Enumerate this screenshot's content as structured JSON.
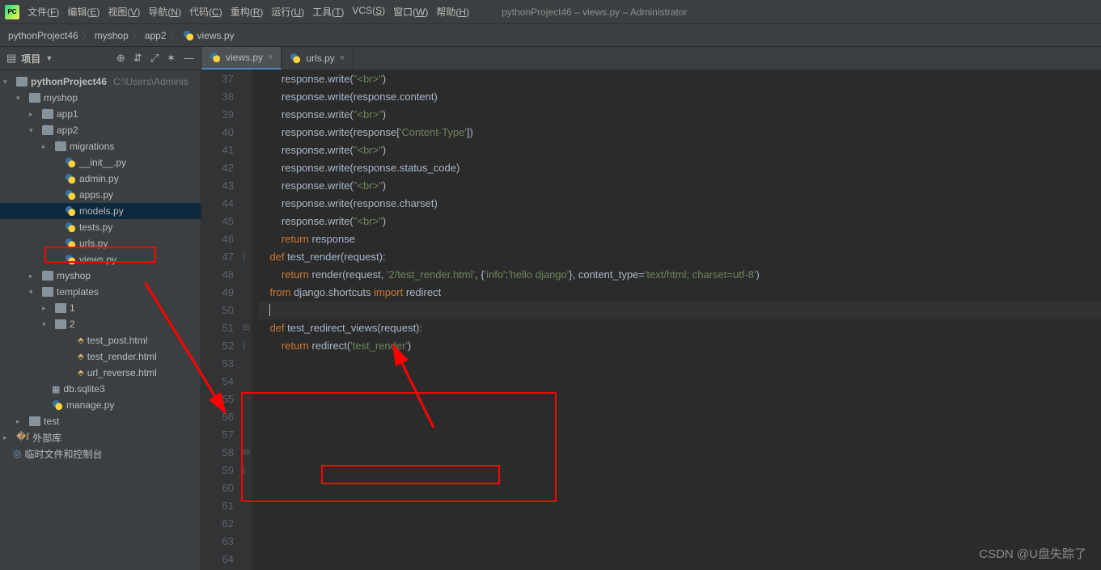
{
  "menu": [
    "文件(F)",
    "编辑(E)",
    "视图(V)",
    "导航(N)",
    "代码(C)",
    "重构(R)",
    "运行(U)",
    "工具(T)",
    "VCS(S)",
    "窗口(W)",
    "帮助(H)"
  ],
  "window_title": "pythonProject46 – views.py – Administrator",
  "breadcrumbs": [
    "pythonProject46",
    "myshop",
    "app2",
    "views.py"
  ],
  "project_label": "项目",
  "tree": {
    "root": {
      "name": "pythonProject46",
      "path": "C:\\Users\\Adminis"
    },
    "myshop": "myshop",
    "app1": "app1",
    "app2": "app2",
    "migrations": "migrations",
    "files_app2": [
      "__init__.py",
      "admin.py",
      "apps.py",
      "models.py",
      "tests.py",
      "urls.py",
      "views.py"
    ],
    "myshop2": "myshop",
    "templates": "templates",
    "tpl1": "1",
    "tpl2": "2",
    "tpl2_files": [
      "test_post.html",
      "test_render.html",
      "url_reverse.html"
    ],
    "db": "db.sqlite3",
    "manage": "manage.py",
    "test": "test",
    "ext_lib": "外部库",
    "scratch": "临时文件和控制台"
  },
  "tabs": [
    {
      "name": "views.py",
      "active": true
    },
    {
      "name": "urls.py",
      "active": false
    }
  ],
  "code_lines": [
    {
      "n": 37,
      "t": [
        {
          "c": "        response.write("
        },
        {
          "c": "\"<br>\"",
          "k": "str"
        },
        {
          "c": ")"
        }
      ]
    },
    {
      "n": 38,
      "t": [
        {
          "c": "        response.write(response.content)"
        }
      ]
    },
    {
      "n": 39,
      "t": [
        {
          "c": "        response.write("
        },
        {
          "c": "\"<br>\"",
          "k": "str"
        },
        {
          "c": ")"
        }
      ]
    },
    {
      "n": 40,
      "t": [
        {
          "c": "        response.write(response["
        },
        {
          "c": "'Content-Type'",
          "k": "str"
        },
        {
          "c": "])"
        }
      ]
    },
    {
      "n": 41,
      "t": [
        {
          "c": "        response.write("
        },
        {
          "c": "\"<br>\"",
          "k": "str"
        },
        {
          "c": ")"
        }
      ]
    },
    {
      "n": 42,
      "t": [
        {
          "c": "        response.write(response.status_code)"
        }
      ]
    },
    {
      "n": 43,
      "t": [
        {
          "c": "        response.write("
        },
        {
          "c": "\"<br>\"",
          "k": "str"
        },
        {
          "c": ")"
        }
      ]
    },
    {
      "n": 44,
      "t": [
        {
          "c": "        response.write(response.charset)"
        }
      ]
    },
    {
      "n": 45,
      "t": [
        {
          "c": "        response.write("
        },
        {
          "c": "\"<br>\"",
          "k": "str"
        },
        {
          "c": ")"
        }
      ]
    },
    {
      "n": 46,
      "t": [
        {
          "c": ""
        }
      ]
    },
    {
      "n": 47,
      "t": [
        {
          "c": "        "
        },
        {
          "c": "return ",
          "k": "kw"
        },
        {
          "c": "response"
        }
      ]
    },
    {
      "n": 48,
      "t": [
        {
          "c": ""
        }
      ]
    },
    {
      "n": 49,
      "t": [
        {
          "c": ""
        }
      ]
    },
    {
      "n": 50,
      "t": [
        {
          "c": ""
        }
      ]
    },
    {
      "n": 51,
      "t": [
        {
          "c": "    "
        },
        {
          "c": "def ",
          "k": "kw"
        },
        {
          "c": "test_render(request):"
        }
      ]
    },
    {
      "n": 52,
      "t": [
        {
          "c": "        "
        },
        {
          "c": "return ",
          "k": "kw"
        },
        {
          "c": "render(request"
        },
        {
          "c": ", "
        },
        {
          "c": "'2/test_render.html'",
          "k": "str"
        },
        {
          "c": ", "
        },
        {
          "c": "{"
        },
        {
          "c": "'info'",
          "k": "str"
        },
        {
          "c": ":"
        },
        {
          "c": "'hello django'",
          "k": "str"
        },
        {
          "c": "}"
        },
        {
          "c": ", "
        },
        {
          "c": "content_type="
        },
        {
          "c": "'text/html; charset=utf-8'",
          "k": "str"
        },
        {
          "c": ")"
        }
      ]
    },
    {
      "n": 53,
      "t": [
        {
          "c": ""
        }
      ]
    },
    {
      "n": 54,
      "t": [
        {
          "c": ""
        }
      ]
    },
    {
      "n": 55,
      "t": [
        {
          "c": ""
        }
      ]
    },
    {
      "n": 56,
      "t": [
        {
          "c": "    "
        },
        {
          "c": "from ",
          "k": "kw"
        },
        {
          "c": "django.shortcuts "
        },
        {
          "c": "import ",
          "k": "kw"
        },
        {
          "c": "redirect"
        }
      ]
    },
    {
      "n": 57,
      "t": [
        {
          "c": "    "
        }
      ],
      "caret": true
    },
    {
      "n": 58,
      "t": [
        {
          "c": "    "
        },
        {
          "c": "def ",
          "k": "kw"
        },
        {
          "c": "test_redirect_views(request):"
        }
      ]
    },
    {
      "n": 59,
      "t": [
        {
          "c": "        "
        },
        {
          "c": "return ",
          "k": "kw"
        },
        {
          "c": "redirect("
        },
        {
          "c": "'test_render'",
          "k": "str"
        },
        {
          "c": ")"
        }
      ]
    },
    {
      "n": 60,
      "t": [
        {
          "c": ""
        }
      ]
    },
    {
      "n": 61,
      "t": [
        {
          "c": ""
        }
      ]
    },
    {
      "n": 62,
      "t": [
        {
          "c": ""
        }
      ]
    },
    {
      "n": 63,
      "t": [
        {
          "c": ""
        }
      ]
    },
    {
      "n": 64,
      "t": [
        {
          "c": ""
        }
      ]
    }
  ],
  "watermark": "CSDN @U盘失踪了"
}
